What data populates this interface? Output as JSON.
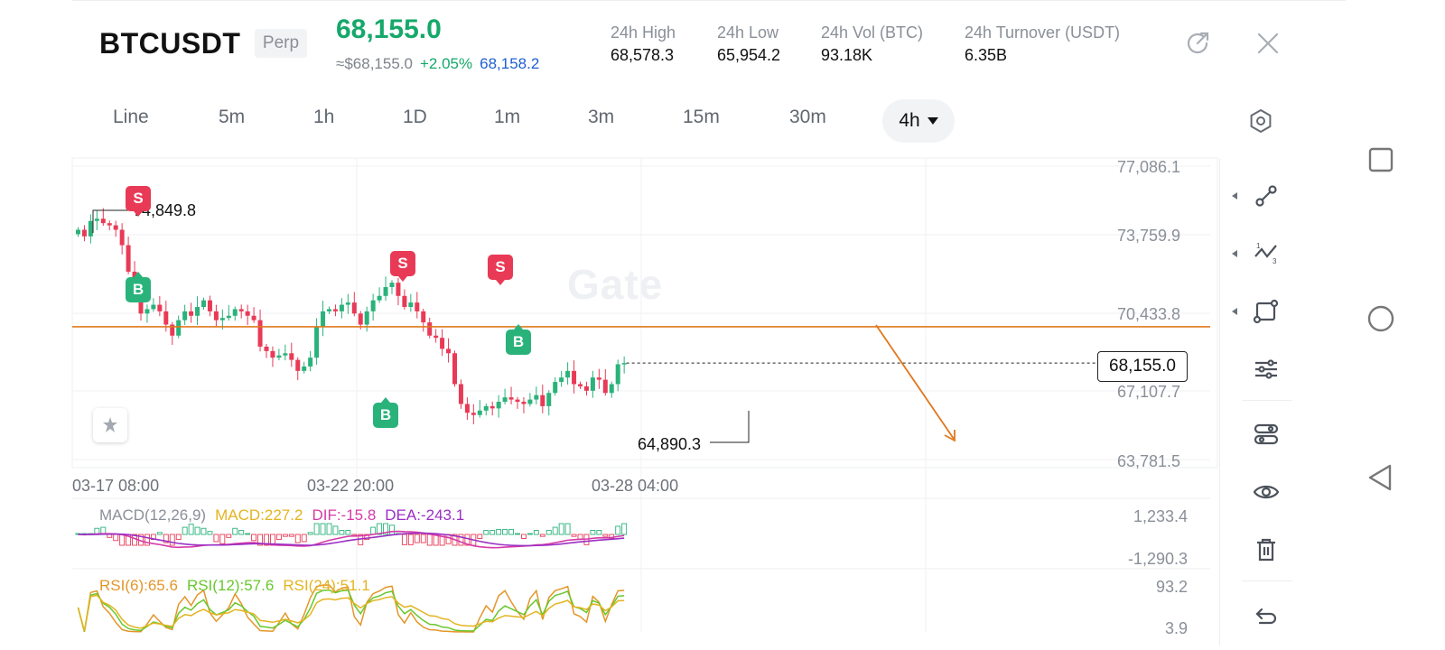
{
  "header": {
    "symbol": "BTCUSDT",
    "contract_type": "Perp",
    "last_price": "68,155.0",
    "fiat_approx": "≈$68,155.0",
    "change_pct": "+2.05%",
    "mark_price": "68,158.2",
    "stats": [
      {
        "label": "24h  High",
        "value": "68,578.3"
      },
      {
        "label": "24h  Low",
        "value": "65,954.2"
      },
      {
        "label": "24h  Vol (BTC)",
        "value": "93.18K"
      },
      {
        "label": "24h  Turnover (USDT)",
        "value": "6.35B"
      }
    ]
  },
  "timeframes": [
    "Line",
    "5m",
    "1h",
    "1D",
    "1m",
    "3m",
    "15m",
    "30m"
  ],
  "active_timeframe": "4h",
  "chart": {
    "watermark": "Gate",
    "current_price_label": "68,155.0",
    "high_annotation": "74,849.8",
    "low_annotation": "64,890.3",
    "y_ticks": [
      "77,086.1",
      "73,759.9",
      "70,433.8",
      "67,107.7",
      "63,781.5"
    ],
    "x_ticks": [
      "03-17 08:00",
      "03-22 20:00",
      "03-28 04:00"
    ],
    "markers": [
      "S",
      "B",
      "S",
      "S",
      "B",
      "B"
    ],
    "colors": {
      "up": "#2ab27b",
      "down": "#e83a56",
      "hline": "#e0781e",
      "arrow": "#e0781e"
    }
  },
  "chart_data": {
    "type": "candlestick",
    "interval": "4h",
    "ylim": [
      63781.5,
      77086.1
    ],
    "x_ticks": [
      "03-17 08:00",
      "03-22 20:00",
      "03-28 04:00"
    ],
    "annotations": {
      "high": 74849.8,
      "low": 64890.3,
      "last": 68155.0,
      "horizontal_line": 69800
    },
    "close_series": [
      74200,
      73900,
      74600,
      74700,
      74500,
      74400,
      74200,
      73500,
      72300,
      71200,
      70400,
      70600,
      70800,
      70500,
      69900,
      69400,
      70100,
      70500,
      70300,
      70700,
      71000,
      70500,
      70100,
      70200,
      70300,
      70600,
      70500,
      70300,
      70100,
      68900,
      68700,
      68400,
      68500,
      68600,
      68300,
      67800,
      68000,
      68400,
      69800,
      70500,
      70600,
      70500,
      70800,
      70900,
      70400,
      69900,
      70500,
      71000,
      71200,
      71600,
      71800,
      71200,
      70700,
      70900,
      70500,
      70000,
      69400,
      69300,
      68800,
      68600,
      67200,
      66300,
      65900,
      65800,
      66000,
      66200,
      66100,
      66400,
      66600,
      66500,
      66400,
      66300,
      66500,
      66700,
      66200,
      66800,
      67300,
      67500,
      67800,
      67200,
      67100,
      66900,
      67500,
      67400,
      66800,
      67200,
      68100,
      68155
    ]
  },
  "indicators": {
    "macd": {
      "name": "MACD(12,26,9)",
      "macd": "MACD:227.2",
      "dif": "DIF:-15.8",
      "dea": "DEA:-243.1",
      "y_top": "1,233.4",
      "y_bottom": "-1,290.3"
    },
    "rsi": {
      "rsi6": "RSI(6):65.6",
      "rsi12": "RSI(12):57.6",
      "rsi24": "RSI(24):51.1",
      "y_top": "93.2",
      "y_bottom": "3.9"
    }
  },
  "toolbar": [
    "trendline-tool",
    "fibonacci-tool",
    "shape-tool",
    "indicator-settings",
    "layout-settings",
    "visibility-toggle",
    "delete-tool",
    "undo-tool"
  ]
}
